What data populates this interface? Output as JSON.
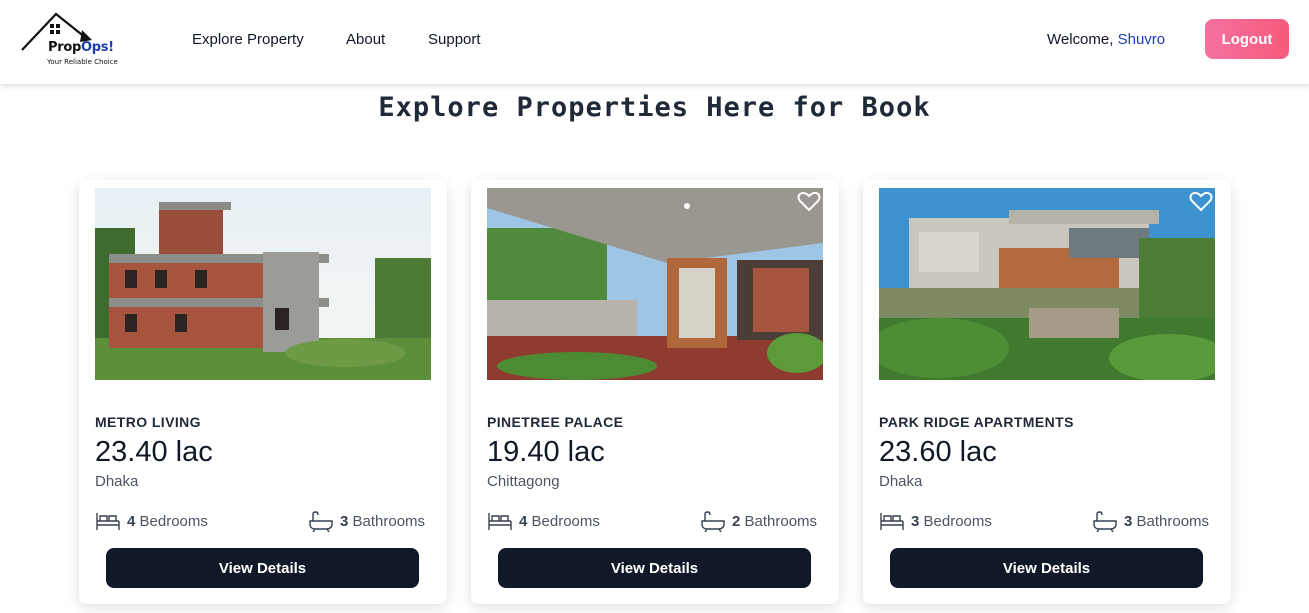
{
  "brand": {
    "name_part1": "Prop",
    "name_part2": "Ops!",
    "tagline": "Your Reliable Choice"
  },
  "nav": {
    "links": [
      "Explore Property",
      "About",
      "Support"
    ]
  },
  "user": {
    "welcome": "Welcome,",
    "name": "Shuvro",
    "logout_label": "Logout"
  },
  "page_title": "Explore Properties Here for Book",
  "cards": [
    {
      "name": "METRO LIVING",
      "price": "23.40 lac",
      "location": "Dhaka",
      "bedrooms": "4",
      "bedrooms_label": "Bedrooms",
      "bathrooms": "3",
      "bathrooms_label": "Bathrooms",
      "button": "View Details"
    },
    {
      "name": "PINETREE PALACE",
      "price": "19.40 lac",
      "location": "Chittagong",
      "bedrooms": "4",
      "bedrooms_label": "Bedrooms",
      "bathrooms": "2",
      "bathrooms_label": "Bathrooms",
      "button": "View Details"
    },
    {
      "name": "PARK RIDGE APARTMENTS",
      "price": "23.60 lac",
      "location": "Dhaka",
      "bedrooms": "3",
      "bedrooms_label": "Bedrooms",
      "bathrooms": "3",
      "bathrooms_label": "Bathrooms",
      "button": "View Details"
    }
  ],
  "colors": {
    "accent": "#1e40af",
    "logout": "#f75a7b",
    "button": "#111827"
  },
  "icons": [
    "house-logo-icon",
    "heart-icon",
    "bed-icon",
    "bathtub-icon"
  ]
}
